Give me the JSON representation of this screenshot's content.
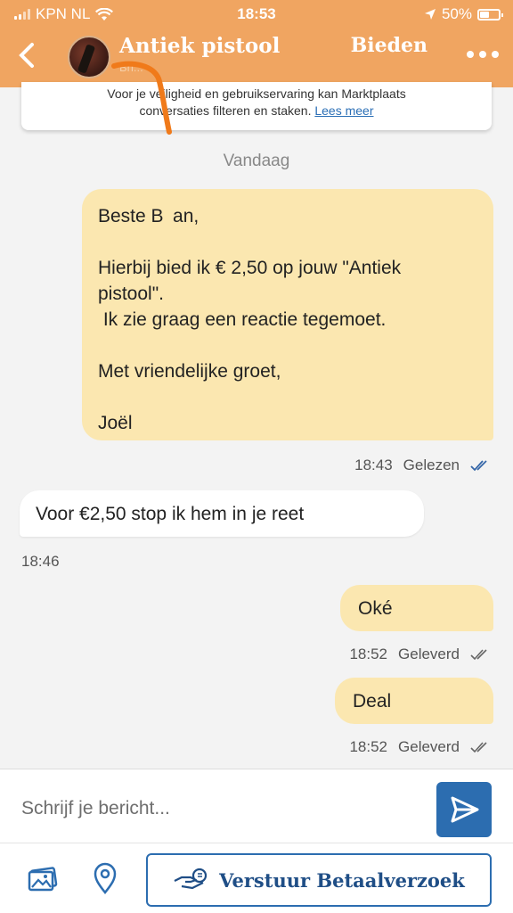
{
  "status_bar": {
    "carrier": "KPN NL",
    "time": "18:53",
    "battery": "50%"
  },
  "header": {
    "title": "Antiek pistool",
    "subtitle": "Bri...",
    "bid_label": "Bieden",
    "more_icon": "more-dots-icon",
    "back_icon": "chevron-left-icon"
  },
  "banner": {
    "text_line1": "Voor je veiligheid en gebruikservaring kan Marktplaats",
    "text_line2": "conversaties filteren en staken. ",
    "link": "Lees meer"
  },
  "date_separator": "Vandaag",
  "messages": [
    {
      "direction": "outgoing",
      "lines": [
        "Beste B an,",
        "",
        "Hierbij bied ik € 2,50 op jouw \"Antiek",
        "pistool\".",
        " Ik zie graag een reactie tegemoet.",
        "",
        "Met vriendelijke groet,",
        "",
        "Joël"
      ],
      "time": "18:43",
      "status": "Gelezen"
    },
    {
      "direction": "incoming",
      "text": "Voor €2,50 stop ik hem in je reet",
      "time": "18:46"
    },
    {
      "direction": "outgoing",
      "text": "Oké",
      "time": "18:52",
      "status": "Geleverd"
    },
    {
      "direction": "outgoing",
      "text": "Deal",
      "time": "18:52",
      "status": "Geleverd"
    }
  ],
  "composer": {
    "placeholder": "Schrijf je bericht...",
    "pay_button": "Verstuur Betaalverzoek"
  },
  "colors": {
    "header_bg": "#f0a561",
    "outgoing_bubble": "#fbe7b0",
    "incoming_bubble": "#ffffff",
    "accent_blue": "#2c6db0"
  }
}
